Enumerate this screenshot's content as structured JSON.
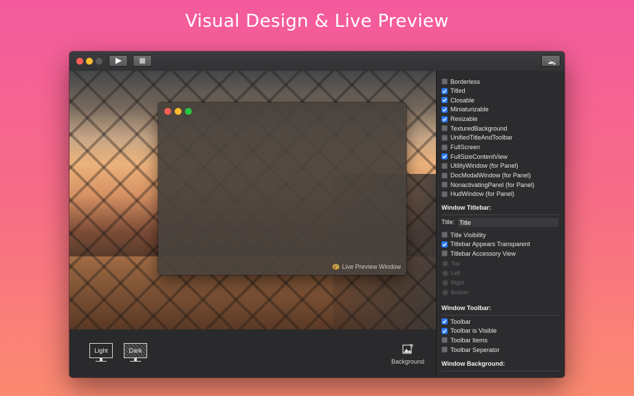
{
  "headline": "Visual Design & Live Preview",
  "colors": {
    "close": "#ff5f57",
    "minimize": "#febc2e",
    "zoom": "#28c840",
    "inactive": "#5a5a5c",
    "accent": "#2f7df6"
  },
  "toolbar": {
    "run_icon": "play-icon",
    "stop_icon": "stop-icon",
    "swift_icon": "swift-icon"
  },
  "preview_window": {
    "caption": "Live Preview Window"
  },
  "appearance": {
    "light_label": "Light",
    "dark_label": "Dark",
    "background_label": "Background"
  },
  "style_mask": [
    {
      "label": "Borderless",
      "checked": false
    },
    {
      "label": "Titled",
      "checked": true
    },
    {
      "label": "Closable",
      "checked": true
    },
    {
      "label": "Miniaturizable",
      "checked": true
    },
    {
      "label": "Resizable",
      "checked": true
    },
    {
      "label": "TexturedBackground",
      "checked": false
    },
    {
      "label": "UnifiedTitleAndToolbar",
      "checked": false
    },
    {
      "label": "FullScreen",
      "checked": false
    },
    {
      "label": "FullSizeContentView",
      "checked": true
    },
    {
      "label": "UtilityWindow (for Panel)",
      "checked": false
    },
    {
      "label": "DocModalWindow (for Panel)",
      "checked": false
    },
    {
      "label": "NonactivatingPanel (for Panel)",
      "checked": false
    },
    {
      "label": "HudWindow (for Panel)",
      "checked": false
    }
  ],
  "titlebar_section": {
    "heading": "Window Titlebar:",
    "title_label": "Title:",
    "title_value": "Title",
    "options": [
      {
        "label": "Title Visibility",
        "checked": false
      },
      {
        "label": "Titlebar Appears Transparent",
        "checked": true
      },
      {
        "label": "Titlebar Accessory View",
        "checked": false
      }
    ],
    "accessory_positions": [
      "Top",
      "Left",
      "Right",
      "Bottom"
    ]
  },
  "toolbar_section": {
    "heading": "Window Toolbar:",
    "options": [
      {
        "label": "Toolbar",
        "checked": true
      },
      {
        "label": "Toolbar is Visible",
        "checked": true
      },
      {
        "label": "Toolbar Items",
        "checked": false
      },
      {
        "label": "Toolbar Seperator",
        "checked": false
      }
    ]
  },
  "background_section": {
    "heading": "Window Background:"
  }
}
